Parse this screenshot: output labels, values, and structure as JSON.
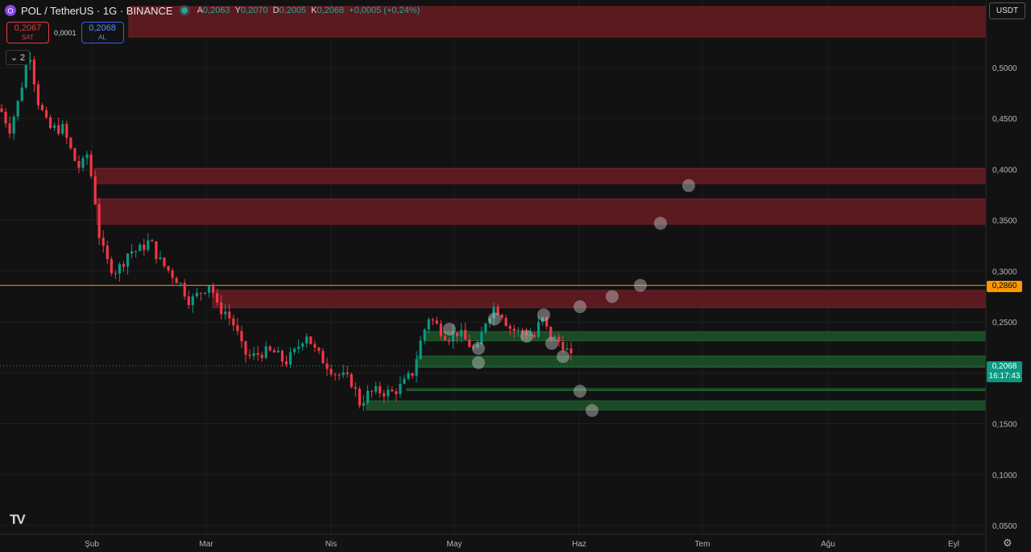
{
  "header": {
    "symbol_icon": "polygon-icon",
    "title": "POL / TetherUS · 1G · BINANCE",
    "ohlc": {
      "open_label": "A",
      "open": "0,2063",
      "high_label": "Y",
      "high": "0,2070",
      "low_label": "D",
      "low": "0,2005",
      "close_label": "K",
      "close": "0,2068",
      "change": "+0,0005 (+0,24%)"
    }
  },
  "trade": {
    "sell_price": "0,2067",
    "sell_label": "SAT",
    "spread": "0,0001",
    "buy_price": "0,2068",
    "buy_label": "AL"
  },
  "indicators_collapse": {
    "count": "2"
  },
  "currency": "USDT",
  "price_tags": {
    "line": "0,2860",
    "last": "0,2068",
    "countdown": "16:17:43"
  },
  "colors": {
    "background": "#121212",
    "up": "#089981",
    "down": "#f23645",
    "resistance_zone": "#5a1a1f",
    "support_zone": "#1b4a26",
    "horizontal_line": "#ff9800"
  },
  "chart_data": {
    "type": "candlestick",
    "ylim": [
      0.04,
      0.54
    ],
    "y_ticks": [
      "0,5000",
      "0,4500",
      "0,4000",
      "0,3500",
      "0,3000",
      "0,2500",
      "0,2000",
      "0,1500",
      "0,1000",
      "0,0500"
    ],
    "x_ticks": [
      "Şub",
      "Mar",
      "Nis",
      "May",
      "Haz",
      "Tem",
      "Ağu",
      "Eyl"
    ],
    "grid": true,
    "horizontal_line": 0.286,
    "last_price": 0.2068,
    "resistance_zones": [
      [
        0.53,
        0.56
      ],
      [
        0.386,
        0.401
      ],
      [
        0.346,
        0.371
      ],
      [
        0.264,
        0.281
      ]
    ],
    "support_zones": [
      [
        0.2315,
        0.2405
      ],
      [
        0.2055,
        0.2165
      ],
      [
        0.1825,
        0.1845
      ],
      [
        0.1635,
        0.1725
      ]
    ],
    "projection_points": [
      [
        0.384
      ],
      [
        0.347
      ],
      [
        0.286
      ],
      [
        0.275
      ],
      [
        0.265
      ],
      [
        0.257
      ],
      [
        0.253
      ],
      [
        0.243
      ],
      [
        0.236
      ],
      [
        0.229
      ],
      [
        0.224
      ],
      [
        0.216
      ],
      [
        0.21
      ],
      [
        0.182
      ],
      [
        0.163
      ]
    ],
    "candles": []
  }
}
